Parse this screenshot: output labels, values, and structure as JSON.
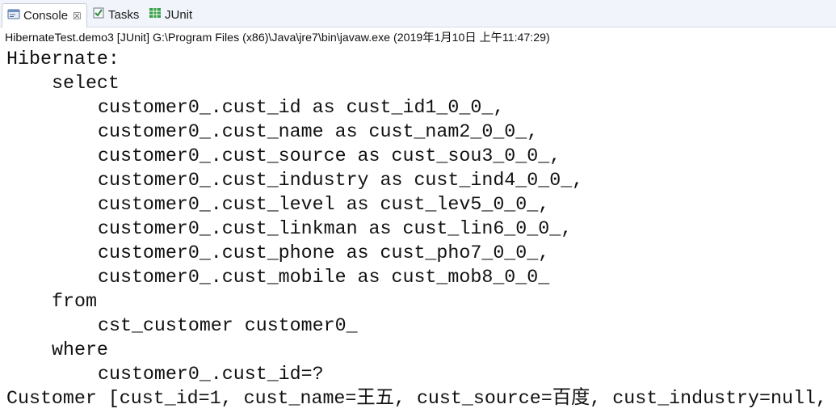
{
  "tabs": {
    "console_label": "Console",
    "console_close": "☒",
    "tasks_label": "Tasks",
    "junit_label": "JUnit"
  },
  "launch": {
    "description": "HibernateTest.demo3 [JUnit] G:\\Program Files (x86)\\Java\\jre7\\bin\\javaw.exe (2019年1月10日 上午11:47:29)"
  },
  "console": {
    "lines": [
      "Hibernate: ",
      "select",
      "customer0_.cust_id as cust_id1_0_0_,",
      "customer0_.cust_name as cust_nam2_0_0_,",
      "customer0_.cust_source as cust_sou3_0_0_,",
      "customer0_.cust_industry as cust_ind4_0_0_,",
      "customer0_.cust_level as cust_lev5_0_0_,",
      "customer0_.cust_linkman as cust_lin6_0_0_,",
      "customer0_.cust_phone as cust_pho7_0_0_,",
      "customer0_.cust_mobile as cust_mob8_0_0_ ",
      "from",
      "cst_customer customer0_ ",
      "where",
      "customer0_.cust_id=?",
      "Customer [cust_id=1, cust_name=王五, cust_source=百度, cust_industry=null,"
    ]
  },
  "icons": {
    "console": "console-icon",
    "tasks": "tasks-icon",
    "junit": "junit-icon"
  },
  "colors": {
    "tabbar_bg": "#f1f5fb",
    "text": "#111111",
    "junit_green": "#3aa04a"
  }
}
